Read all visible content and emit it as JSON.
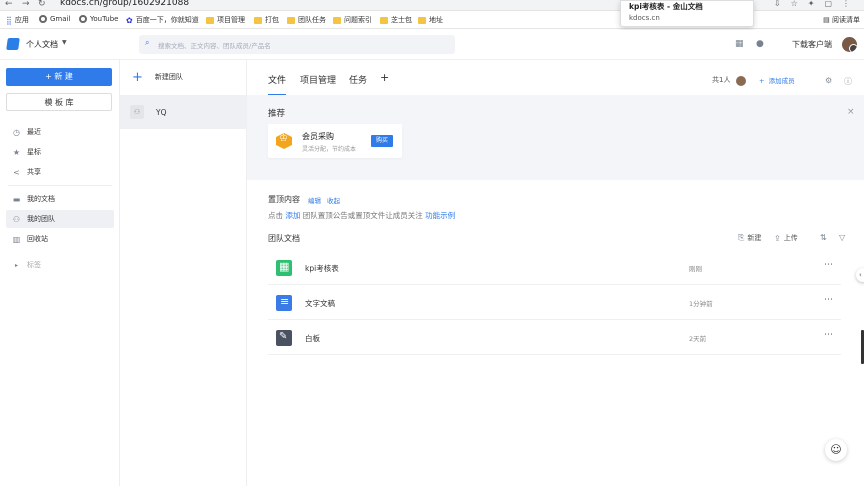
{
  "browser": {
    "url": "kdocs.cn/group/1602921088",
    "bookmarks": [
      {
        "label": "应用",
        "icon": "apps-icon"
      },
      {
        "label": "Gmail",
        "icon": "google-icon"
      },
      {
        "label": "YouTube",
        "icon": "google-icon"
      },
      {
        "label": "百度一下，你就知道",
        "icon": "baidu-icon"
      },
      {
        "label": "项目管理",
        "icon": "folder-icon"
      },
      {
        "label": "打包",
        "icon": "folder-icon"
      },
      {
        "label": "团队任务",
        "icon": "folder-icon"
      },
      {
        "label": "问题索引",
        "icon": "folder-icon"
      },
      {
        "label": "芝士包",
        "icon": "folder-icon"
      },
      {
        "label": "地址",
        "icon": "folder-icon"
      }
    ],
    "reading_list": "阅读清单",
    "tab_tooltip": {
      "title": "kpi考核表 - 金山文档",
      "host": "kdocs.cn"
    }
  },
  "topbar": {
    "workspace": "个人文档",
    "search_placeholder": "搜索文档、正文内容、团队成员/产品名",
    "download": "下载客户端"
  },
  "leftnav": {
    "new_button": "+ 新 建",
    "template_button": "模 板 库",
    "items": [
      {
        "label": "最近",
        "icon": "clock-icon"
      },
      {
        "label": "星标",
        "icon": "star-icon"
      },
      {
        "label": "共享",
        "icon": "share-icon"
      },
      {
        "label": "我的文档",
        "icon": "folder-icon"
      },
      {
        "label": "我的团队",
        "icon": "team-icon"
      },
      {
        "label": "回收站",
        "icon": "trash-icon"
      },
      {
        "label": "标签",
        "icon": "tag-icon"
      }
    ]
  },
  "teams": {
    "new_team": "新建团队",
    "items": [
      {
        "name": "YQ"
      }
    ]
  },
  "main": {
    "tabs": [
      "文件",
      "项目管理",
      "任务"
    ],
    "add_tab": "+",
    "members": "共1人",
    "add_member": "添加成员",
    "recommend": {
      "title": "推荐",
      "card_title": "会员采购",
      "card_subtitle": "灵活分配，节约成本",
      "buy": "购买"
    },
    "pinned": {
      "title": "置顶内容",
      "edit": "编辑",
      "collapse": "收起",
      "hint_prefix": "点击",
      "hint_add": "添加",
      "hint_middle": "团队置顶公告或置顶文件让成员关注",
      "hint_example": "功能示例"
    },
    "team_docs": {
      "title": "团队文档",
      "new": "新建",
      "upload": "上传",
      "files": [
        {
          "name": "kpi考核表",
          "time": "刚刚",
          "type": "sheet"
        },
        {
          "name": "文字文稿",
          "time": "1分钟前",
          "type": "doc"
        },
        {
          "name": "白板",
          "time": "2天前",
          "type": "board"
        }
      ]
    }
  }
}
